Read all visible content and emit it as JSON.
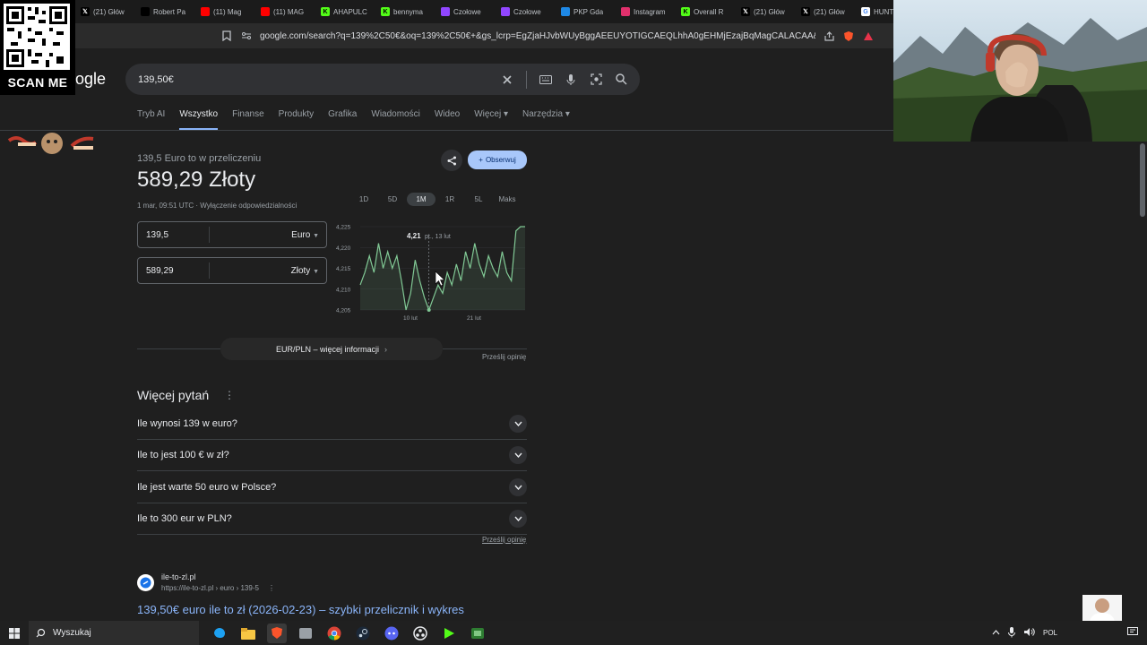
{
  "browser": {
    "tabs": [
      {
        "label": "(21) Głów",
        "icon": "x-icon",
        "color": "#000000"
      },
      {
        "label": "Robert Pa",
        "icon": "tiktok-icon",
        "color": "#000000"
      },
      {
        "label": "(11) Mag",
        "icon": "youtube-icon",
        "color": "#ff0000"
      },
      {
        "label": "(11) MAG",
        "icon": "youtube-icon",
        "color": "#ff0000"
      },
      {
        "label": "AHAPULC",
        "icon": "kick-icon",
        "color": "#53fc18"
      },
      {
        "label": "bennyma",
        "icon": "kick-icon",
        "color": "#53fc18"
      },
      {
        "label": "Czołowe",
        "icon": "twitch-icon",
        "color": "#9146ff"
      },
      {
        "label": "Czołowe",
        "icon": "twitch-icon",
        "color": "#9146ff"
      },
      {
        "label": "PKP Gda",
        "icon": "pkp-icon",
        "color": "#1e88e5"
      },
      {
        "label": "Instagram",
        "icon": "instagram-icon",
        "color": "#e1306c"
      },
      {
        "label": "Overall R",
        "icon": "kick-icon",
        "color": "#53fc18"
      },
      {
        "label": "(21) Głów",
        "icon": "x-icon",
        "color": "#000000"
      },
      {
        "label": "(21) Głów",
        "icon": "x-icon",
        "color": "#000000"
      },
      {
        "label": "HUNTSM",
        "icon": "google-icon",
        "color": "#ffffff"
      }
    ],
    "url": "google.com/search?q=139%2C50€&oq=139%2C50€+&gs_lcrp=EgZjaHJvbWUyBggAEEUYOTIGCAEQLhhA0gEHMjEzajBqMagCALACAA&sourceid=ch..."
  },
  "overlay": {
    "scan_label": "SCAN ME",
    "logo_fragment": "ogle"
  },
  "search": {
    "query": "139,50€",
    "tabs": [
      "Tryb AI",
      "Wszystko",
      "Finanse",
      "Produkty",
      "Grafika",
      "Wiadomości",
      "Wideo",
      "Więcej ▾",
      "Narzędzia ▾"
    ],
    "active_tab": "Wszystko"
  },
  "converter": {
    "subtitle": "139,5 Euro to w przeliczeniu",
    "result": "589,29 Złoty",
    "meta": "1 mar, 09:51 UTC · Wyłączenie odpowiedzialności",
    "follow_label": "Obserwuj",
    "from_value": "139,5",
    "from_currency": "Euro",
    "to_value": "589,29",
    "to_currency": "Złoty",
    "ranges": [
      "1D",
      "5D",
      "1M",
      "1R",
      "5L",
      "Maks"
    ],
    "selected_range": "1M",
    "more_info": "EUR/PLN – więcej informacji",
    "feedback": "Prześlij opinię",
    "tooltip_value": "4,21",
    "tooltip_date": "pt., 13 lut"
  },
  "chart_data": {
    "type": "line",
    "y_ticks": [
      "4,225",
      "4,220",
      "4,215",
      "4,210",
      "4,205"
    ],
    "x_ticks": [
      "10 lut",
      "21 lut"
    ],
    "ylim": [
      4.205,
      4.225
    ],
    "color": "#81c995",
    "values": [
      4.211,
      4.214,
      4.218,
      4.214,
      4.221,
      4.215,
      4.219,
      4.215,
      4.218,
      4.212,
      4.205,
      4.209,
      4.217,
      4.212,
      4.208,
      4.205,
      4.208,
      4.211,
      4.209,
      4.214,
      4.211,
      4.216,
      4.212,
      4.219,
      4.215,
      4.221,
      4.216,
      4.213,
      4.218,
      4.215,
      4.213,
      4.219,
      4.214,
      4.212,
      4.224,
      4.225,
      4.225
    ]
  },
  "paa": {
    "title": "Więcej pytań",
    "questions": [
      "Ile wynosi 139 w euro?",
      "Ile to jest 100 € w zł?",
      "Ile jest warte 50 euro w Polsce?",
      "Ile to 300 eur w PLN?"
    ],
    "feedback": "Prześlij opinię"
  },
  "result": {
    "site": "ile-to-zl.pl",
    "url": "https://ile-to-zl.pl › euro › 139-5",
    "title": "139,50€ euro ile to zł (2026-02-23) – szybki przelicznik i wykres"
  },
  "taskbar": {
    "search_placeholder": "Wyszukaj",
    "language": "POL"
  }
}
